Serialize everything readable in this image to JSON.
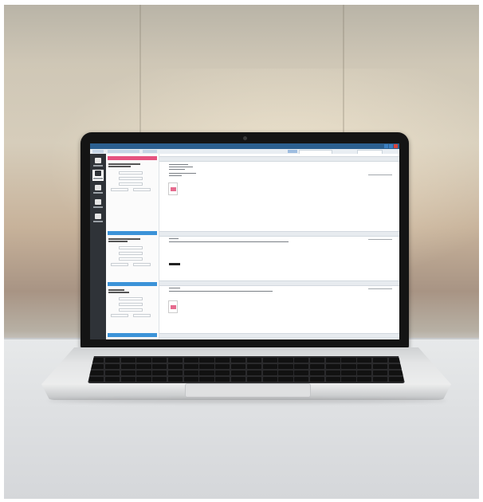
{
  "colors": {
    "titlebar": "#2b5f8f",
    "nav_background": "#2f3338",
    "accent_blue": "#3c93d8",
    "accent_pink": "#e5527f",
    "close_button": "#d9443d"
  },
  "icons": {
    "nav": [
      "inbox-icon",
      "document-icon",
      "printer-icon",
      "phone-icon",
      "monitor-icon"
    ]
  }
}
